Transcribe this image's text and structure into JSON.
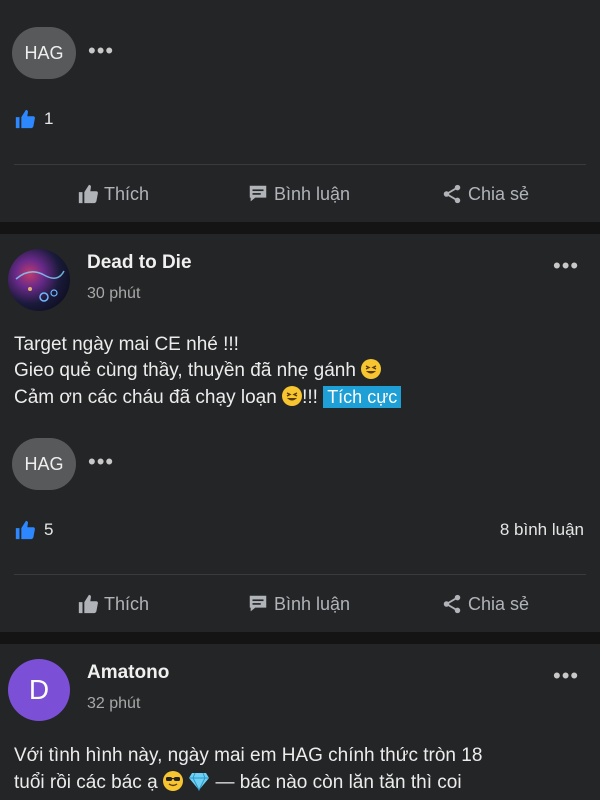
{
  "post1": {
    "tag": "HAG",
    "likes": "1"
  },
  "actions": {
    "like": "Thích",
    "comment": "Bình luận",
    "share": "Chia sẻ"
  },
  "post2": {
    "author": "Dead to Die",
    "time": "30 phút",
    "lines": [
      "Target ngày mai CE nhé !!!",
      "Gieo quẻ cùng thầy, thuyền đã nhẹ gánh",
      "Cảm ơn các cháu đã chạy loạn",
      "!!!"
    ],
    "badge": "Tích cực",
    "tag": "HAG",
    "likes": "5",
    "comments": "8 bình luận"
  },
  "post3": {
    "author": "Amatono",
    "avatar_letter": "D",
    "avatar_color": "#7b4fd6",
    "time": "32 phút",
    "lines": [
      "Với tình hình này, ngày mai em HAG chính thức tròn 18",
      "tuổi rồi các bác ạ",
      "— bác nào còn lăn tăn thì coi"
    ]
  },
  "colors": {
    "like_blue": "#2d88ff",
    "badge_blue": "#1e9fd6"
  }
}
